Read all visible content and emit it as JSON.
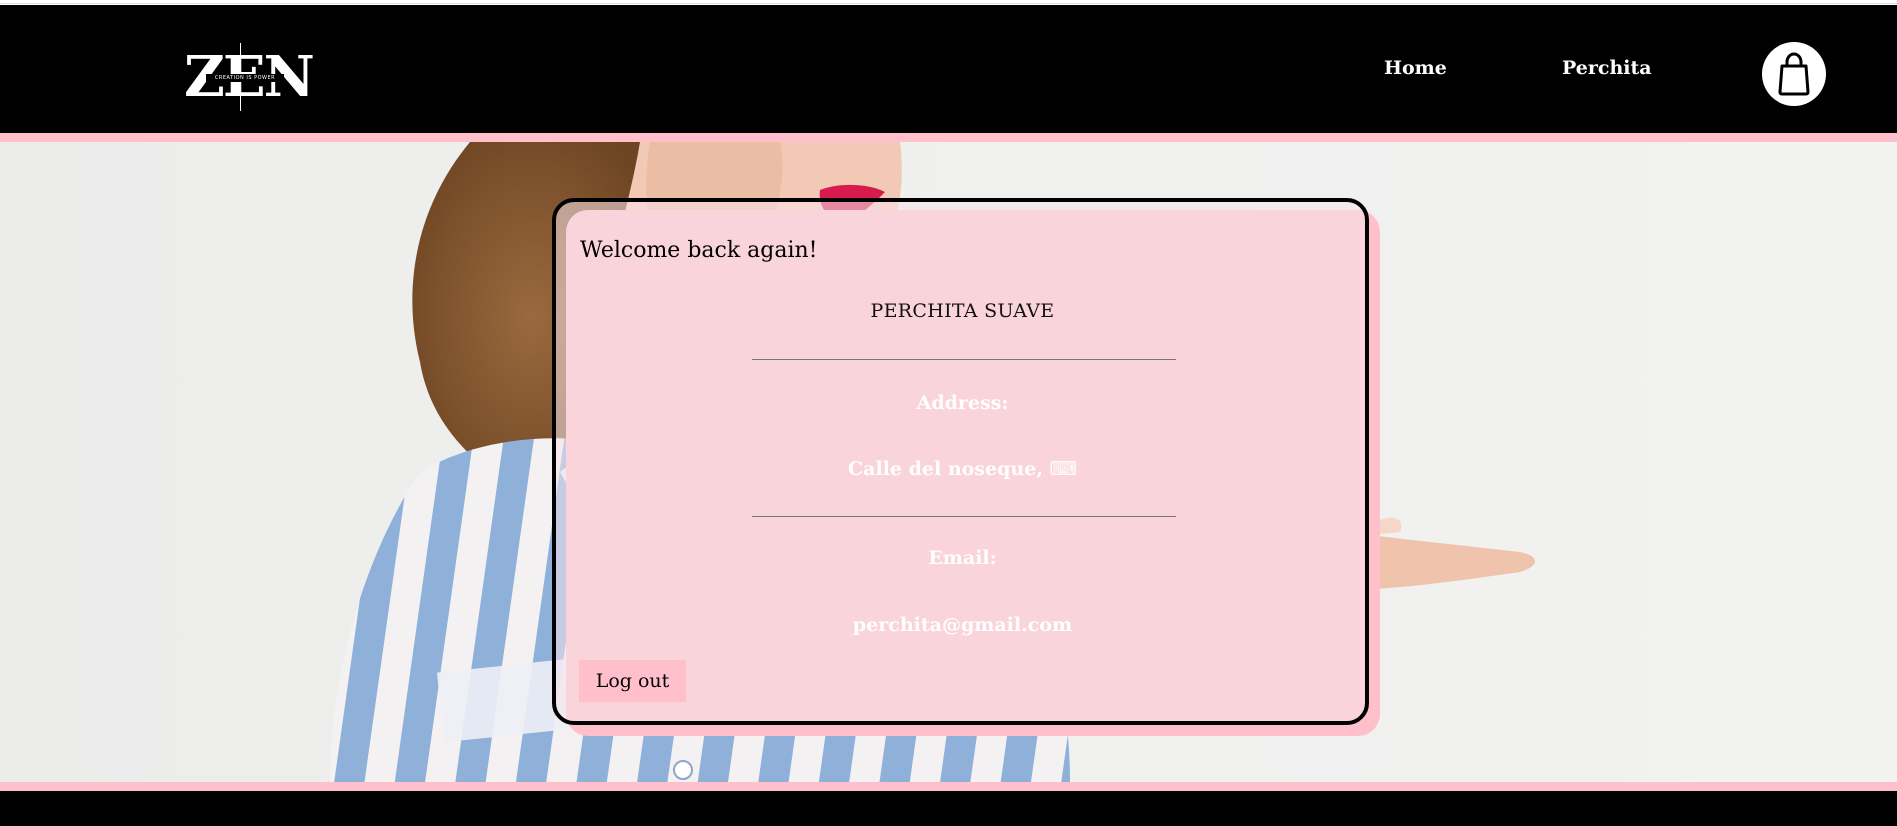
{
  "header": {
    "logo_text": "ZEN",
    "logo_tagline": "CREATION IS POWER",
    "nav": [
      {
        "label": "Home"
      },
      {
        "label": "Perchita"
      }
    ],
    "cart_icon": "shopping-bag-icon"
  },
  "colors": {
    "header_bg": "#000000",
    "accent_pink": "#ffc0cb",
    "text_light": "#ffffff"
  },
  "profile": {
    "greeting": "Welcome back again!",
    "username": "PERCHITA SUAVE",
    "address_label": "Address:",
    "address_value": "Calle del noseque, ⌨",
    "email_label": "Email:",
    "email_value": "perchita@gmail.com",
    "logout_label": "Log out"
  }
}
